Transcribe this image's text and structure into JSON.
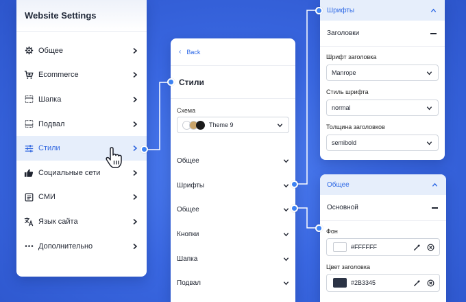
{
  "settings_panel": {
    "title": "Website Settings",
    "items": [
      {
        "label": "Общее",
        "icon": "gear-icon"
      },
      {
        "label": "Ecommerce",
        "icon": "cart-icon"
      },
      {
        "label": "Шапка",
        "icon": "header-layout-icon"
      },
      {
        "label": "Подвал",
        "icon": "footer-layout-icon"
      },
      {
        "label": "Стили",
        "icon": "sliders-icon",
        "active": true
      },
      {
        "label": "Социальные сети",
        "icon": "thumbs-up-icon"
      },
      {
        "label": "СМИ",
        "icon": "media-icon"
      },
      {
        "label": "Язык сайта",
        "icon": "translate-icon"
      },
      {
        "label": "Дополнительно",
        "icon": "more-dots-icon"
      }
    ]
  },
  "styles_panel": {
    "back_label": "Back",
    "title": "Стили",
    "scheme_label": "Схема",
    "scheme_value": "Theme 9",
    "scheme_swatches": [
      "#ffffff",
      "#c9a46a",
      "#1b1b1b"
    ],
    "sections": [
      "Общее",
      "Шрифты",
      "Общее",
      "Кнопки",
      "Шапка",
      "Подвал"
    ]
  },
  "fonts_panel": {
    "title": "Шрифты",
    "sub_title": "Заголовки",
    "fields": [
      {
        "label": "Шрифт заголовка",
        "value": "Manrope"
      },
      {
        "label": "Стиль шрифта",
        "value": "normal"
      },
      {
        "label": "Толщина заголовков",
        "value": "semibold"
      }
    ]
  },
  "general_panel": {
    "title": "Общее",
    "sub_title": "Основной",
    "colors": [
      {
        "label": "Фон",
        "value": "#FFFFFF"
      },
      {
        "label": "Цвет заголовка",
        "value": "#2B3345"
      }
    ]
  },
  "theme": {
    "accent": "#2f6ae6",
    "active_bg": "#e6eefb",
    "dot": "#3d82f2"
  }
}
